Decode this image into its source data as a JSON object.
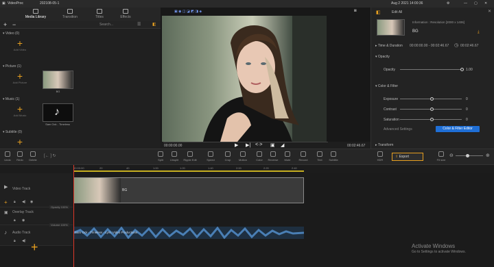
{
  "titlebar": {
    "app_name": "VideoProc",
    "project": "202108-05-1",
    "datetime": "Aug 2 2021 14:00:36"
  },
  "library_tabs": [
    {
      "label": "Media Library",
      "active": true
    },
    {
      "label": "Transition",
      "active": false
    },
    {
      "label": "Titles",
      "active": false
    },
    {
      "label": "Effects",
      "active": false
    }
  ],
  "search": {
    "placeholder": "Search..."
  },
  "library": {
    "sections": [
      {
        "label": "Video (0)",
        "add_label": "Add Video"
      },
      {
        "label": "Picture (1)",
        "add_label": "Add Picture"
      },
      {
        "label": "Music (1)",
        "add_label": "Add Music"
      },
      {
        "label": "Subtitle (0)",
        "add_label": ""
      }
    ],
    "picture_caption": "BG",
    "music_caption": "Sam Ock - Timeless"
  },
  "preview": {
    "time_current": "00:00:00.00",
    "time_total": "00:02:46.67"
  },
  "right_panel": {
    "edit_all": "Edit All",
    "info": "Information : Resolution [2000 x 1406]",
    "clip_name": "BG",
    "time_duration_label": "Time & Duration",
    "time_range": "00:00:00.00 - 00:02:46.67",
    "duration": "00:02:46.67",
    "opacity_section": "Opacity",
    "opacity_label": "Opacity",
    "opacity_value": "1.00",
    "color_filter_section": "Color & Filter",
    "exposure_label": "Exposure",
    "exposure_value": "0",
    "contrast_label": "Contrast",
    "contrast_value": "0",
    "saturation_label": "Saturation",
    "saturation_value": "0",
    "advanced_label": "Advanced Settings",
    "color_filter_button": "Color & Filter Editor",
    "transform_section": "Transform"
  },
  "toolbar": {
    "undo": "Undo",
    "redo": "Redo",
    "delete": "Delete",
    "split": "Split",
    "unsplit": "Unsplit",
    "ripple_edit": "Ripple Edit",
    "speed": "Speed",
    "crop": "Crop",
    "motion": "Motion",
    "color": "Color",
    "reverse": "Reverse",
    "mute": "Mute",
    "record": "Record",
    "text": "Text",
    "subtitle": "Subtitle",
    "hdr": "HDR",
    "export": "Export",
    "fit_size": "Fit size"
  },
  "ruler": {
    "start": "00:00:00",
    "ticks": [
      "20",
      "40",
      "1:00",
      "1:20",
      "1:40",
      "2:00",
      "2:20",
      "2:40"
    ]
  },
  "tracks": {
    "video_track": "Video Track",
    "video_clip_label": "BG",
    "overlay_track": "Overlay Track",
    "overlay_opacity": "Opacity 100%",
    "audio_track": "Audio Track",
    "audio_opacity": "Volume 100%",
    "audio_clip_label": "Sam Ock - Timeless - Lyric Video Productions"
  },
  "watermark": {
    "line1": "Activate Windows",
    "line2": "Go to Settings to activate Windows."
  },
  "colors": {
    "accent": "#ff6a33",
    "add_plus": "#e8a020",
    "button_blue": "#1f6fd6",
    "playhead": "#e03a2a",
    "audio_wave": "#4a7fb5"
  }
}
